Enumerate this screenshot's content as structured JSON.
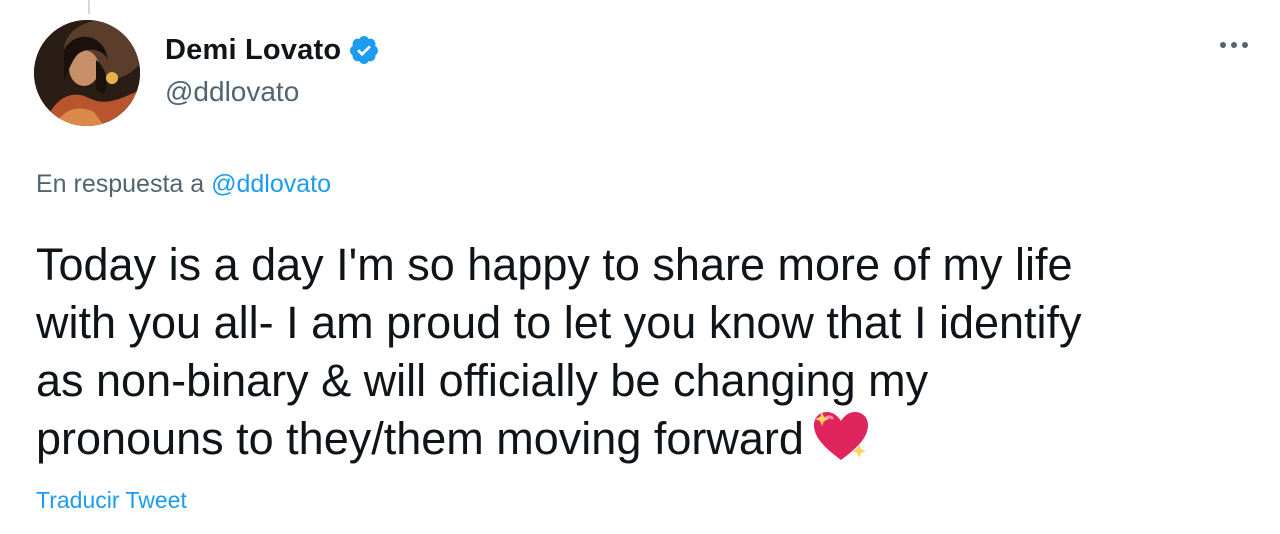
{
  "author": {
    "display_name": "Demi Lovato",
    "handle": "@ddlovato",
    "verified": true,
    "avatar_icon": "profile-photo"
  },
  "reply": {
    "prefix": "En respuesta a ",
    "mention": "@ddlovato"
  },
  "tweet": {
    "line1": "Today is a day I'm so happy to share more of my life",
    "line2": "with you all- I am proud to let you know that I identify",
    "line3": "as non-binary & will officially be changing my",
    "line4": "pronouns to they/them moving forward",
    "emoji": "sparkling-heart-icon"
  },
  "actions": {
    "translate_label": "Traducir Tweet",
    "more_icon": "more-options-icon"
  },
  "colors": {
    "accent": "#1d9bf0",
    "secondary_text": "#536471",
    "primary_text": "#0f1419",
    "heart": "#e0245e"
  }
}
